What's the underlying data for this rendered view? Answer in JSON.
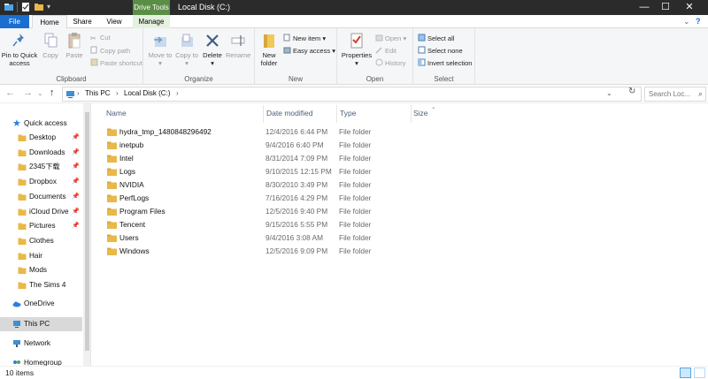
{
  "window": {
    "context_tab": "Drive Tools",
    "title": "Local Disk (C:)",
    "controls": {
      "minimize": "—",
      "maximize": "☐",
      "close": "✕"
    }
  },
  "tabs": {
    "file": "File",
    "home": "Home",
    "share": "Share",
    "view": "View",
    "manage": "Manage",
    "help_icon": "?"
  },
  "ribbon": {
    "clipboard": {
      "label": "Clipboard",
      "pin_to_quick_access": "Pin to Quick access",
      "copy": "Copy",
      "paste": "Paste",
      "cut": "Cut",
      "copy_path": "Copy path",
      "paste_shortcut": "Paste shortcut"
    },
    "organize": {
      "label": "Organize",
      "move_to": "Move to",
      "copy_to": "Copy to",
      "delete": "Delete",
      "rename": "Rename"
    },
    "new": {
      "label": "New",
      "new_folder": "New folder",
      "new_item": "New item",
      "easy_access": "Easy access"
    },
    "open": {
      "label": "Open",
      "properties": "Properties",
      "open": "Open",
      "edit": "Edit",
      "history": "History"
    },
    "select": {
      "label": "Select",
      "select_all": "Select all",
      "select_none": "Select none",
      "invert_selection": "Invert selection"
    }
  },
  "address": {
    "crumbs": [
      "This PC",
      "Local Disk (C:)"
    ],
    "search_placeholder": "Search Loc..."
  },
  "nav": {
    "quick_access": "Quick access",
    "items": [
      {
        "label": "Desktop",
        "pinned": true
      },
      {
        "label": "Downloads",
        "pinned": true
      },
      {
        "label": "2345下载",
        "pinned": true
      },
      {
        "label": "Dropbox",
        "pinned": true
      },
      {
        "label": "Documents",
        "pinned": true
      },
      {
        "label": "iCloud Drive",
        "pinned": true
      },
      {
        "label": "Pictures",
        "pinned": true
      },
      {
        "label": "Clothes",
        "pinned": false
      },
      {
        "label": "Hair",
        "pinned": false
      },
      {
        "label": "Mods",
        "pinned": false
      },
      {
        "label": "The Sims 4",
        "pinned": false
      }
    ],
    "onedrive": "OneDrive",
    "this_pc": "This PC",
    "network": "Network",
    "homegroup": "Homegroup"
  },
  "columns": {
    "name": "Name",
    "date": "Date modified",
    "type": "Type",
    "size": "Size"
  },
  "files": [
    {
      "name": "hydra_tmp_1480848296492",
      "date": "12/4/2016 6:44 PM",
      "type": "File folder"
    },
    {
      "name": "inetpub",
      "date": "9/4/2016 6:40 PM",
      "type": "File folder"
    },
    {
      "name": "Intel",
      "date": "8/31/2014 7:09 PM",
      "type": "File folder"
    },
    {
      "name": "Logs",
      "date": "9/10/2015 12:15 PM",
      "type": "File folder"
    },
    {
      "name": "NVIDIA",
      "date": "8/30/2010 3:49 PM",
      "type": "File folder"
    },
    {
      "name": "PerfLogs",
      "date": "7/16/2016 4:29 PM",
      "type": "File folder"
    },
    {
      "name": "Program Files",
      "date": "12/5/2016 9:40 PM",
      "type": "File folder"
    },
    {
      "name": "Tencent",
      "date": "9/15/2016 5:55 PM",
      "type": "File folder"
    },
    {
      "name": "Users",
      "date": "9/4/2016 3:08 AM",
      "type": "File folder"
    },
    {
      "name": "Windows",
      "date": "12/5/2016 9:09 PM",
      "type": "File folder"
    }
  ],
  "status": {
    "count": "10 items"
  },
  "colors": {
    "accent": "#1a6ecf",
    "context": "#5a8e46",
    "folder": "#e8b84a",
    "selected": "#d9d9d9"
  }
}
